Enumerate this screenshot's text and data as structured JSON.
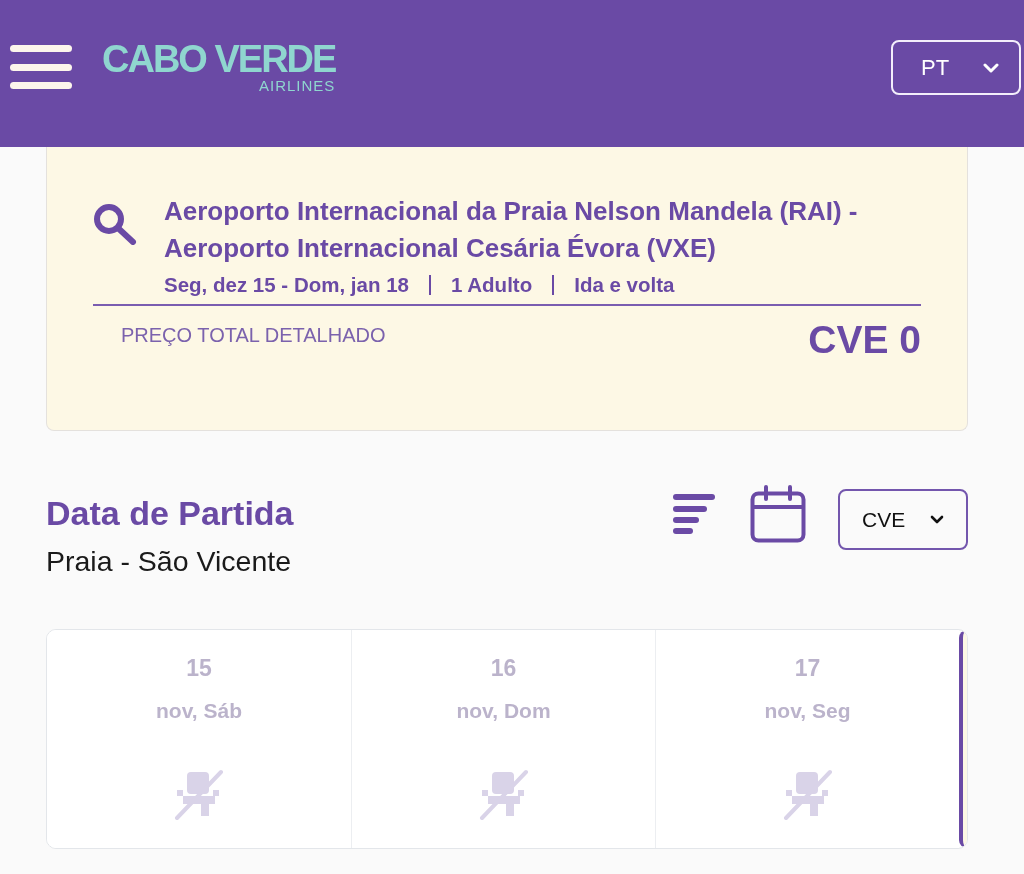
{
  "header": {
    "logo": {
      "name": "CABO VERDE",
      "tagline": "AIRLINES"
    },
    "language": {
      "value": "PT"
    }
  },
  "summary": {
    "route": "Aeroporto Internacional da Praia Nelson Mandela (RAI) - Aeroporto Internacional Cesária Évora (VXE)",
    "details": [
      "Seg, dez 15 - Dom, jan 18",
      "1 Adulto",
      "Ida e volta"
    ],
    "price_label": "PREÇO TOTAL DETALHADO",
    "price": "CVE 0"
  },
  "departure": {
    "title": "Data de Partida",
    "route": "Praia - São Vicente",
    "currency": {
      "value": "CVE"
    }
  },
  "days": [
    {
      "day": "15",
      "label": "nov, Sáb",
      "available": false,
      "selected": false
    },
    {
      "day": "16",
      "label": "nov, Dom",
      "available": false,
      "selected": false
    },
    {
      "day": "17",
      "label": "nov, Seg",
      "available": false,
      "selected": false
    },
    {
      "selected": true
    }
  ]
}
